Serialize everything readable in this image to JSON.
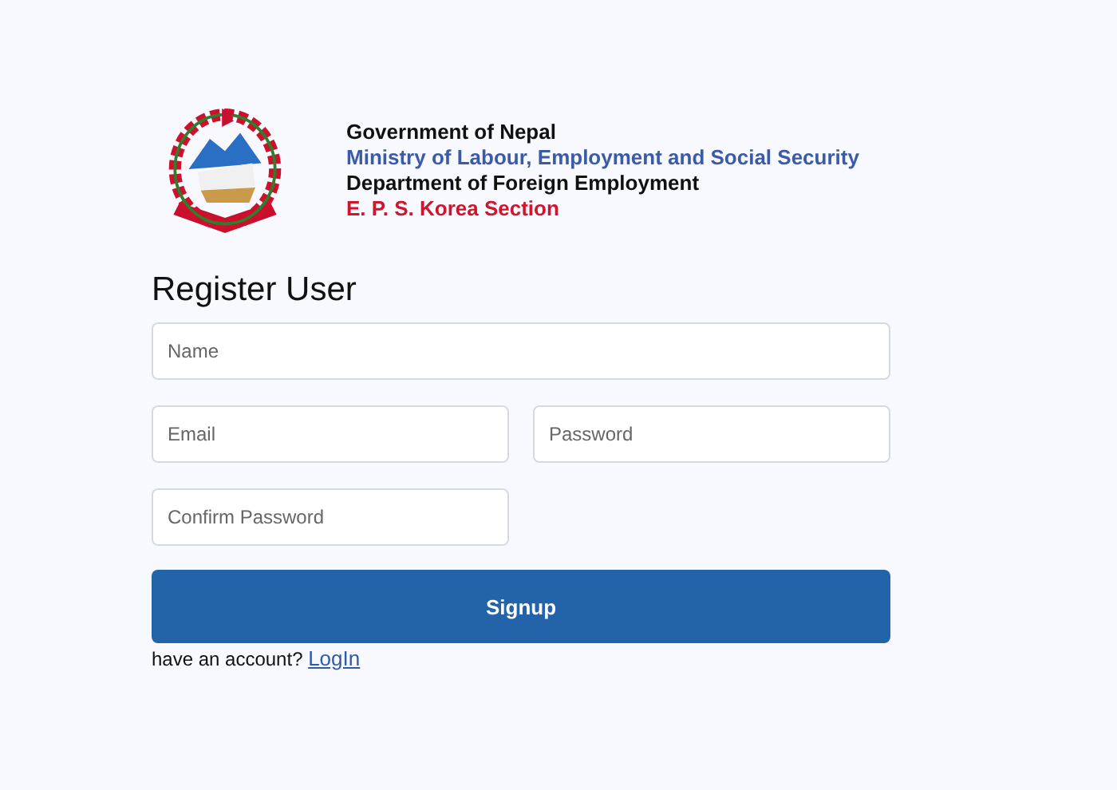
{
  "header": {
    "lines": [
      {
        "text": "Government of Nepal",
        "color": "#111111"
      },
      {
        "text": "Ministry of Labour, Employment and Social Security",
        "color": "#3b5ba8"
      },
      {
        "text": "Department of Foreign Employment",
        "color": "#111111"
      },
      {
        "text": "E. P. S. Korea Section",
        "color": "#d0142c"
      }
    ]
  },
  "form": {
    "title": "Register User",
    "rows": [
      [
        {
          "placeholder": "Name"
        }
      ],
      [
        {
          "placeholder": "Email"
        },
        {
          "placeholder": "Password"
        }
      ],
      [
        {
          "placeholder": "Confirm Password"
        }
      ]
    ],
    "submit": "Signup",
    "footer": {
      "text": "have an account?",
      "link": "LogIn"
    }
  }
}
